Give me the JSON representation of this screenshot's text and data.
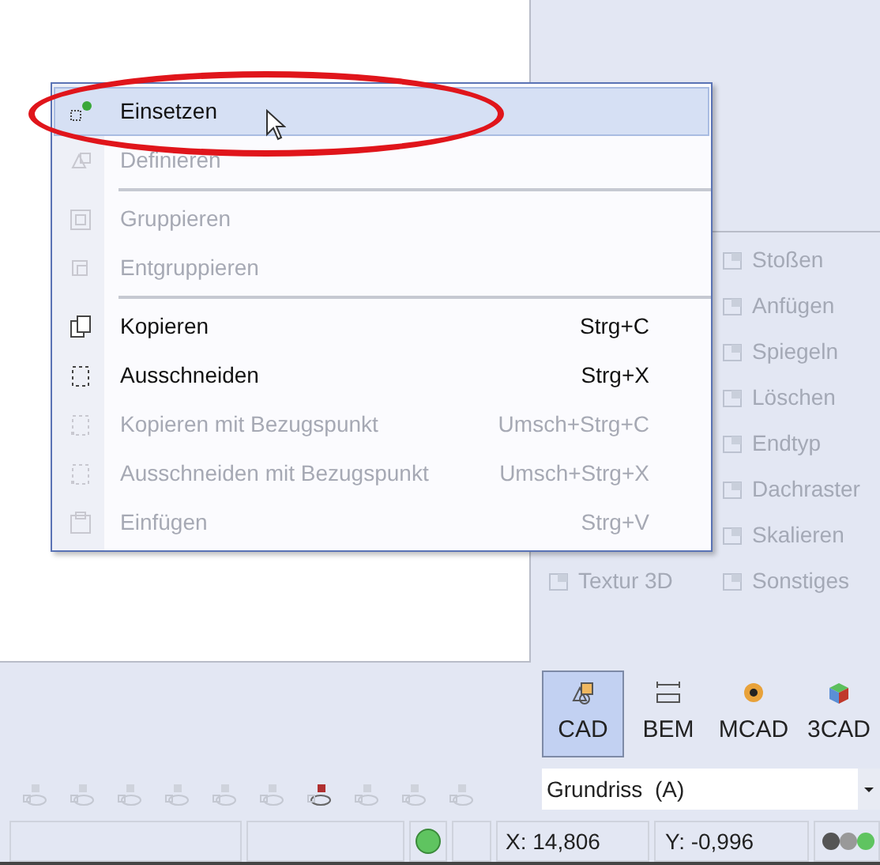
{
  "context_menu": {
    "items": [
      {
        "kind": "item",
        "label": "Einsetzen",
        "disabled": false,
        "highlighted": true
      },
      {
        "kind": "item",
        "label": "Definieren",
        "disabled": true,
        "highlighted": false
      },
      {
        "kind": "separator"
      },
      {
        "kind": "item",
        "label": "Gruppieren",
        "disabled": true,
        "highlighted": false
      },
      {
        "kind": "item",
        "label": "Entgruppieren",
        "disabled": true,
        "highlighted": false
      },
      {
        "kind": "separator"
      },
      {
        "kind": "item",
        "label": "Kopieren",
        "shortcut": "Strg+C",
        "disabled": false,
        "highlighted": false
      },
      {
        "kind": "item",
        "label": "Ausschneiden",
        "shortcut": "Strg+X",
        "disabled": false,
        "highlighted": false
      },
      {
        "kind": "item",
        "label": "Kopieren mit Bezugspunkt",
        "shortcut": "Umsch+Strg+C",
        "disabled": true,
        "highlighted": false
      },
      {
        "kind": "item",
        "label": "Ausschneiden mit Bezugspunkt",
        "shortcut": "Umsch+Strg+X",
        "disabled": true,
        "highlighted": false
      },
      {
        "kind": "item",
        "label": "Einfügen",
        "shortcut": "Strg+V",
        "disabled": true,
        "highlighted": false
      }
    ]
  },
  "tools_left": [
    {
      "label": "Textur 3D",
      "disabled": true
    }
  ],
  "tools_right": [
    {
      "label": "Stoßen",
      "disabled": true
    },
    {
      "label": "Anfügen",
      "disabled": true
    },
    {
      "label": "Spiegeln",
      "disabled": true
    },
    {
      "label": "Löschen",
      "disabled": true
    },
    {
      "label": "Endtyp",
      "disabled": true
    },
    {
      "label": "Dachraster",
      "disabled": true
    },
    {
      "label": "Skalieren",
      "disabled": true
    },
    {
      "label": "Sonstiges",
      "disabled": true
    }
  ],
  "modes": [
    {
      "label": "CAD",
      "selected": true
    },
    {
      "label": "BEM",
      "selected": false
    },
    {
      "label": "MCAD",
      "selected": false
    },
    {
      "label": "3CAD",
      "selected": false
    }
  ],
  "view_select": {
    "value": "Grundriss  (A)"
  },
  "status_bar": {
    "x": "X: 14,806",
    "y": "Y: -0,996"
  }
}
